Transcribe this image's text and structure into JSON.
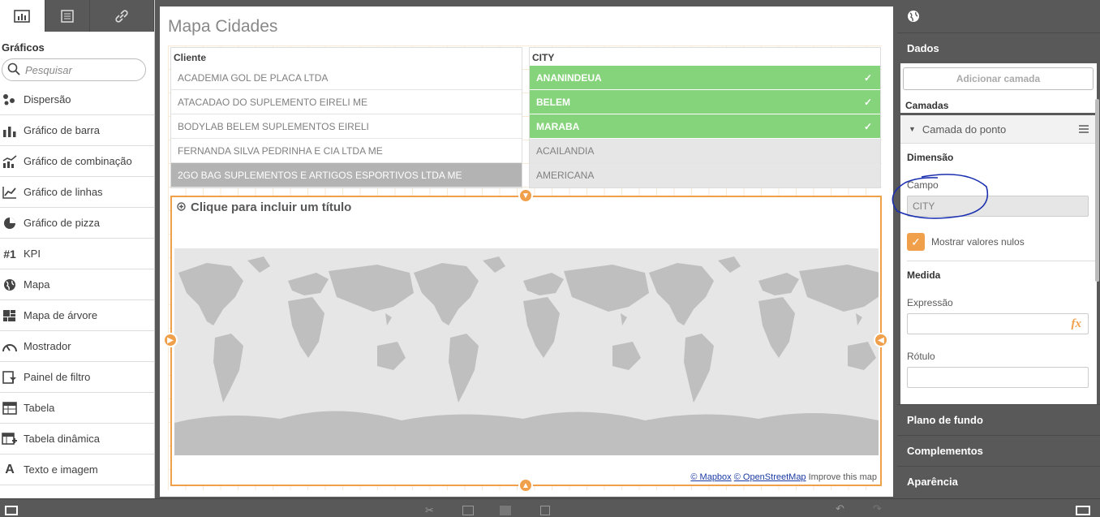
{
  "left_panel": {
    "tabs": [
      {
        "icon": "chart-icon"
      },
      {
        "icon": "list-icon"
      },
      {
        "icon": "link-icon"
      }
    ],
    "heading": "Gráficos",
    "search_placeholder": "Pesquisar",
    "items": [
      {
        "label": "Dispersão",
        "icon": "scatter-icon"
      },
      {
        "label": "Gráfico de barra",
        "icon": "bar-chart-icon"
      },
      {
        "label": "Gráfico de combinação",
        "icon": "combo-chart-icon"
      },
      {
        "label": "Gráfico de linhas",
        "icon": "line-chart-icon"
      },
      {
        "label": "Gráfico de pizza",
        "icon": "pie-chart-icon"
      },
      {
        "label": "KPI",
        "icon": "kpi-icon"
      },
      {
        "label": "Mapa",
        "icon": "globe-icon"
      },
      {
        "label": "Mapa de árvore",
        "icon": "treemap-icon"
      },
      {
        "label": "Mostrador",
        "icon": "gauge-icon"
      },
      {
        "label": "Painel de filtro",
        "icon": "filter-pane-icon"
      },
      {
        "label": "Tabela",
        "icon": "table-icon"
      },
      {
        "label": "Tabela dinâmica",
        "icon": "pivot-table-icon"
      },
      {
        "label": "Texto e imagem",
        "icon": "text-icon"
      }
    ]
  },
  "sheet": {
    "title": "Mapa Cidades",
    "cliente_filter": {
      "header": "Cliente",
      "rows": [
        {
          "label": "ACADEMIA GOL DE PLACA LTDA",
          "state": "normal"
        },
        {
          "label": "ATACADAO DO SUPLEMENTO EIRELI ME",
          "state": "normal"
        },
        {
          "label": "BODYLAB BELEM SUPLEMENTOS EIRELI",
          "state": "normal"
        },
        {
          "label": "FERNANDA SILVA PEDRINHA E CIA LTDA ME",
          "state": "normal"
        },
        {
          "label": "2GO BAG SUPLEMENTOS E ARTIGOS ESPORTIVOS LTDA ME",
          "state": "excluded"
        }
      ]
    },
    "city_filter": {
      "header": "CITY",
      "rows": [
        {
          "label": "ANANINDEUA",
          "state": "selected"
        },
        {
          "label": "BELEM",
          "state": "selected"
        },
        {
          "label": "MARABA",
          "state": "selected"
        },
        {
          "label": "ACAILANDIA",
          "state": "alternative"
        },
        {
          "label": "AMERICANA",
          "state": "alternative"
        }
      ]
    },
    "map": {
      "title_placeholder": "Clique para incluir um título",
      "attribution_mapbox": "© Mapbox",
      "attribution_osm": "© OpenStreetMap",
      "attribution_improve": "Improve this map"
    }
  },
  "properties": {
    "top_icon": "globe-icon",
    "dados": "Dados",
    "add_layer": "Adicionar camada",
    "camadas": "Camadas",
    "layer_name": "Camada do ponto",
    "dimensao": "Dimensão",
    "campo_label": "Campo",
    "campo_value": "CITY",
    "show_nulls": "Mostrar valores nulos",
    "medida": "Medida",
    "expressao_label": "Expressão",
    "expressao_value": "",
    "rotulo_label": "Rótulo",
    "sections": [
      "Plano de fundo",
      "Complementos",
      "Aparência"
    ]
  },
  "colors": {
    "selected": "#85d37a",
    "accent": "#f0a04b",
    "annotation": "#1a2fb0"
  }
}
